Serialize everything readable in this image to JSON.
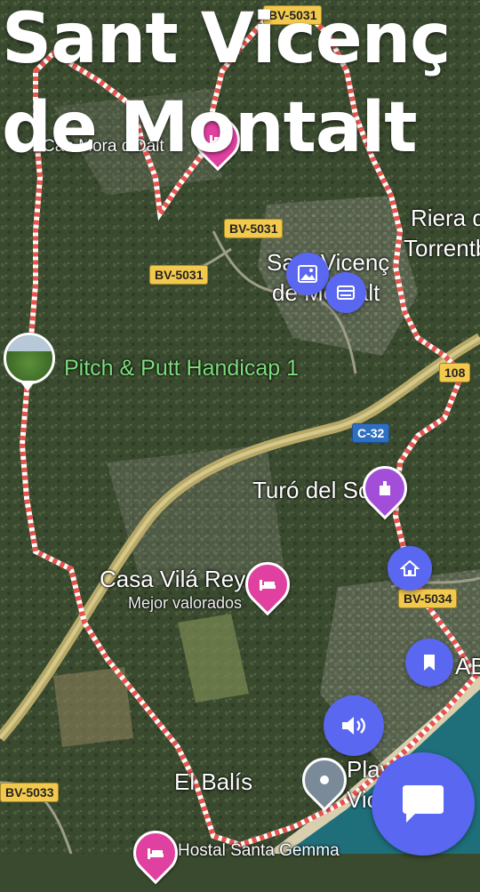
{
  "title_line1": "Sant Vicenç",
  "title_line2": "de Montalt",
  "roads": {
    "bv5031_top": "BV-5031",
    "bv5031_mid": "BV-5031",
    "bv5031_left": "BV-5031",
    "c32": "C-32",
    "r108": "108",
    "bv5034": "BV-5034",
    "bv5033": "BV-5033"
  },
  "places": {
    "can_mora": "Can Mora d'Dalt",
    "riera_line1": "Riera d",
    "riera_line2": "Torrentb",
    "sant_vicenc_line1": "Sant Vicenç",
    "sant_vicenc_line2": "de Montalt",
    "pitch_putt": "Pitch & Putt Handicap 1",
    "turo_sol": "Turó del Sol",
    "casa_vila": "Casa Vilá Reyes",
    "casa_vila_sub": "Mejor valorados",
    "el_balis": "El Balís",
    "playa_line1": "Playa",
    "playa_line2": "Vic",
    "ab": "AB",
    "hostal": "Hostal Santa Gemma"
  },
  "icons": {
    "photo_button": "image-icon",
    "card_button": "card-icon",
    "home_button": "home-icon",
    "bookmark_button": "bookmark-icon",
    "speaker_button": "speaker-icon",
    "chat_button": "chat-icon"
  },
  "colors": {
    "accent": "#5a67f0",
    "hotel_pin": "#e040a0",
    "attraction_pin": "#a24ed8",
    "boundary": "#e8534a",
    "sea": "#1e6f7a"
  }
}
